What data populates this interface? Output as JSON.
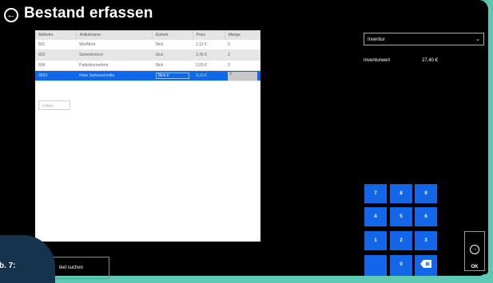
{
  "header": {
    "title": "Bestand erfassen",
    "back_icon": "back-arrow-icon"
  },
  "table": {
    "columns": [
      "Artikelnr.",
      "Artikelname",
      "Einheit",
      "Preis",
      "Menge"
    ],
    "rows": [
      [
        "501",
        "Weißbrot",
        "Stck",
        "2,12 €",
        "5"
      ],
      [
        "603",
        "Steinofenbrot",
        "Stck",
        "3,45 €",
        "2"
      ],
      [
        "604",
        "Paderbornerbrot",
        "Stck",
        "2,00 €",
        "3"
      ],
      [
        "3653",
        "Kleie Sahneschnitte",
        "Stck",
        "3,10 €",
        "2"
      ]
    ],
    "selected_row_index": 3,
    "new_item_placeholder": "Artikeln..."
  },
  "right_panel": {
    "dropdown_value": "Inventur",
    "inventory_label": "Inventurwert",
    "inventory_value": "27,40 €"
  },
  "keypad": {
    "k7": "7",
    "k8": "8",
    "k9": "9",
    "k4": "4",
    "k5": "5",
    "k6": "6",
    "k1": "1",
    "k2": "2",
    "k3": "3",
    "k0": "0",
    "backspace_icon": "backspace-icon",
    "ok_label": "OK"
  },
  "footer": {
    "search_label": "ikel suchen",
    "figure_badge": "b. 7:"
  },
  "colors": {
    "accent": "#1466e8",
    "frame": "#5ec9b4",
    "badge": "#16334d"
  }
}
